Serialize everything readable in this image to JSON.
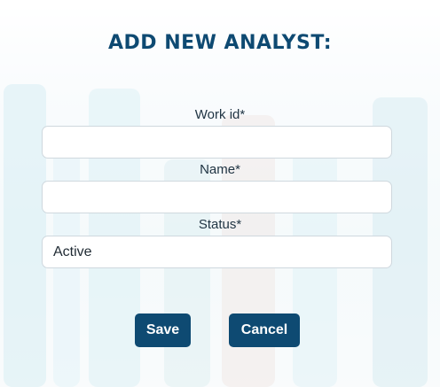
{
  "form": {
    "title": "ADD NEW ANALYST:",
    "fields": [
      {
        "label": "Work id*",
        "value": ""
      },
      {
        "label": "Name*",
        "value": ""
      },
      {
        "label": "Status*",
        "value": "Active"
      }
    ],
    "save_label": "Save",
    "cancel_label": "Cancel"
  },
  "colors": {
    "accent": "#0e4a72",
    "label_text": "#1f3342"
  }
}
